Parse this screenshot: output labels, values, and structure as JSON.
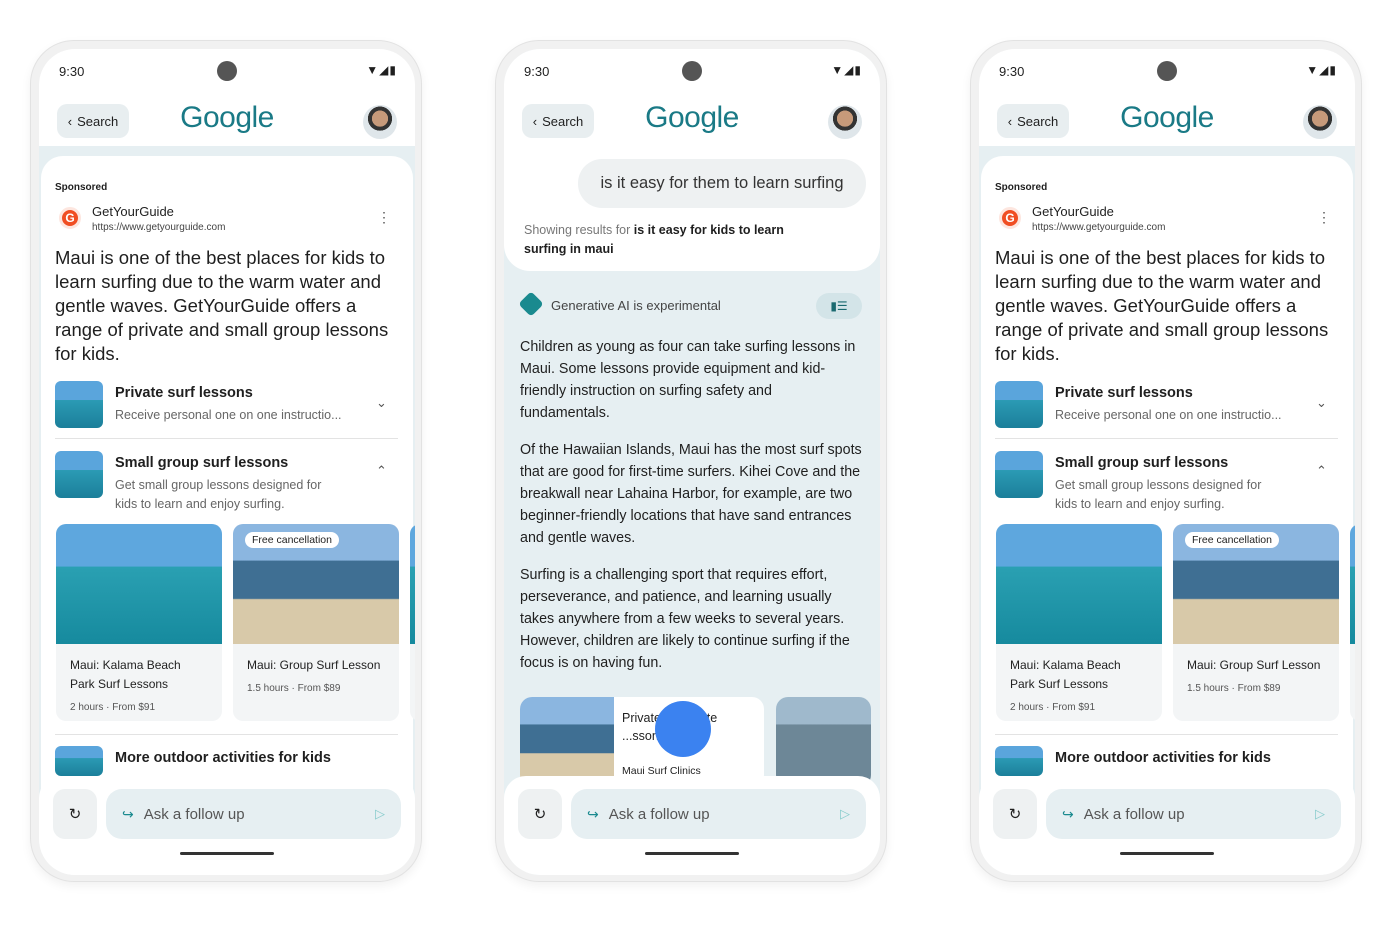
{
  "status": {
    "time": "9:30",
    "icons": "▼◢▮"
  },
  "header": {
    "back_label": "Search",
    "logo": "Google"
  },
  "ad": {
    "sponsored": "Sponsored",
    "advertiser": "GetYourGuide",
    "url": "https://www.getyourguide.com",
    "favicon": "G",
    "body": "Maui is one of the best places for kids to learn surfing due to the warm water and gentle waves. GetYourGuide offers a range of private and small group lessons for kids.",
    "rows": [
      {
        "title": "Private surf lessons",
        "subtitle": "Receive personal one on one instructio..."
      },
      {
        "title": "Small group surf lessons",
        "subtitle": "Get small group lessons designed for kids to learn and enjoy surfing."
      },
      {
        "title": "More outdoor activities for kids"
      }
    ],
    "cards": [
      {
        "title": "Maui: Kalama Beach Park Surf Lessons",
        "meta": "2 hours · From $91"
      },
      {
        "badge": "Free cancellation",
        "title": "Maui: Group Surf Lesson",
        "meta": "1.5 hours · From $89"
      }
    ]
  },
  "followup": {
    "query": "is it easy for them to learn surfing",
    "showing_prefix": "Showing results for ",
    "showing_query": "is it easy for kids to learn surfing in maui",
    "ai_label": "Generative AI is experimental",
    "paragraphs": [
      "Children as young as four can take surfing lessons in Maui. Some lessons provide equipment and kid-friendly instruction on surfing safety and fundamentals.",
      "Of the Hawaiian Islands, Maui has the most surf spots that are good for first-time surfers. Kihei Cove and the breakwall near Lahaina Harbor, for example, are two beginner-friendly locations that have sand entrances and gentle waves.",
      "Surfing is a challenging sport that requires effort, perseverance, and patience, and learning usually takes anywhere from a few weeks to several years. However, children are likely to continue surfing if the focus is on having fun."
    ],
    "source_card": {
      "title": "Private ... Private ...ssons in Maui",
      "source": "Maui Surf Clinics"
    }
  },
  "bottom": {
    "ask_placeholder": "Ask a follow up"
  },
  "colors": {
    "accent": "#1a8a8f",
    "touch": "#3b82f0"
  }
}
